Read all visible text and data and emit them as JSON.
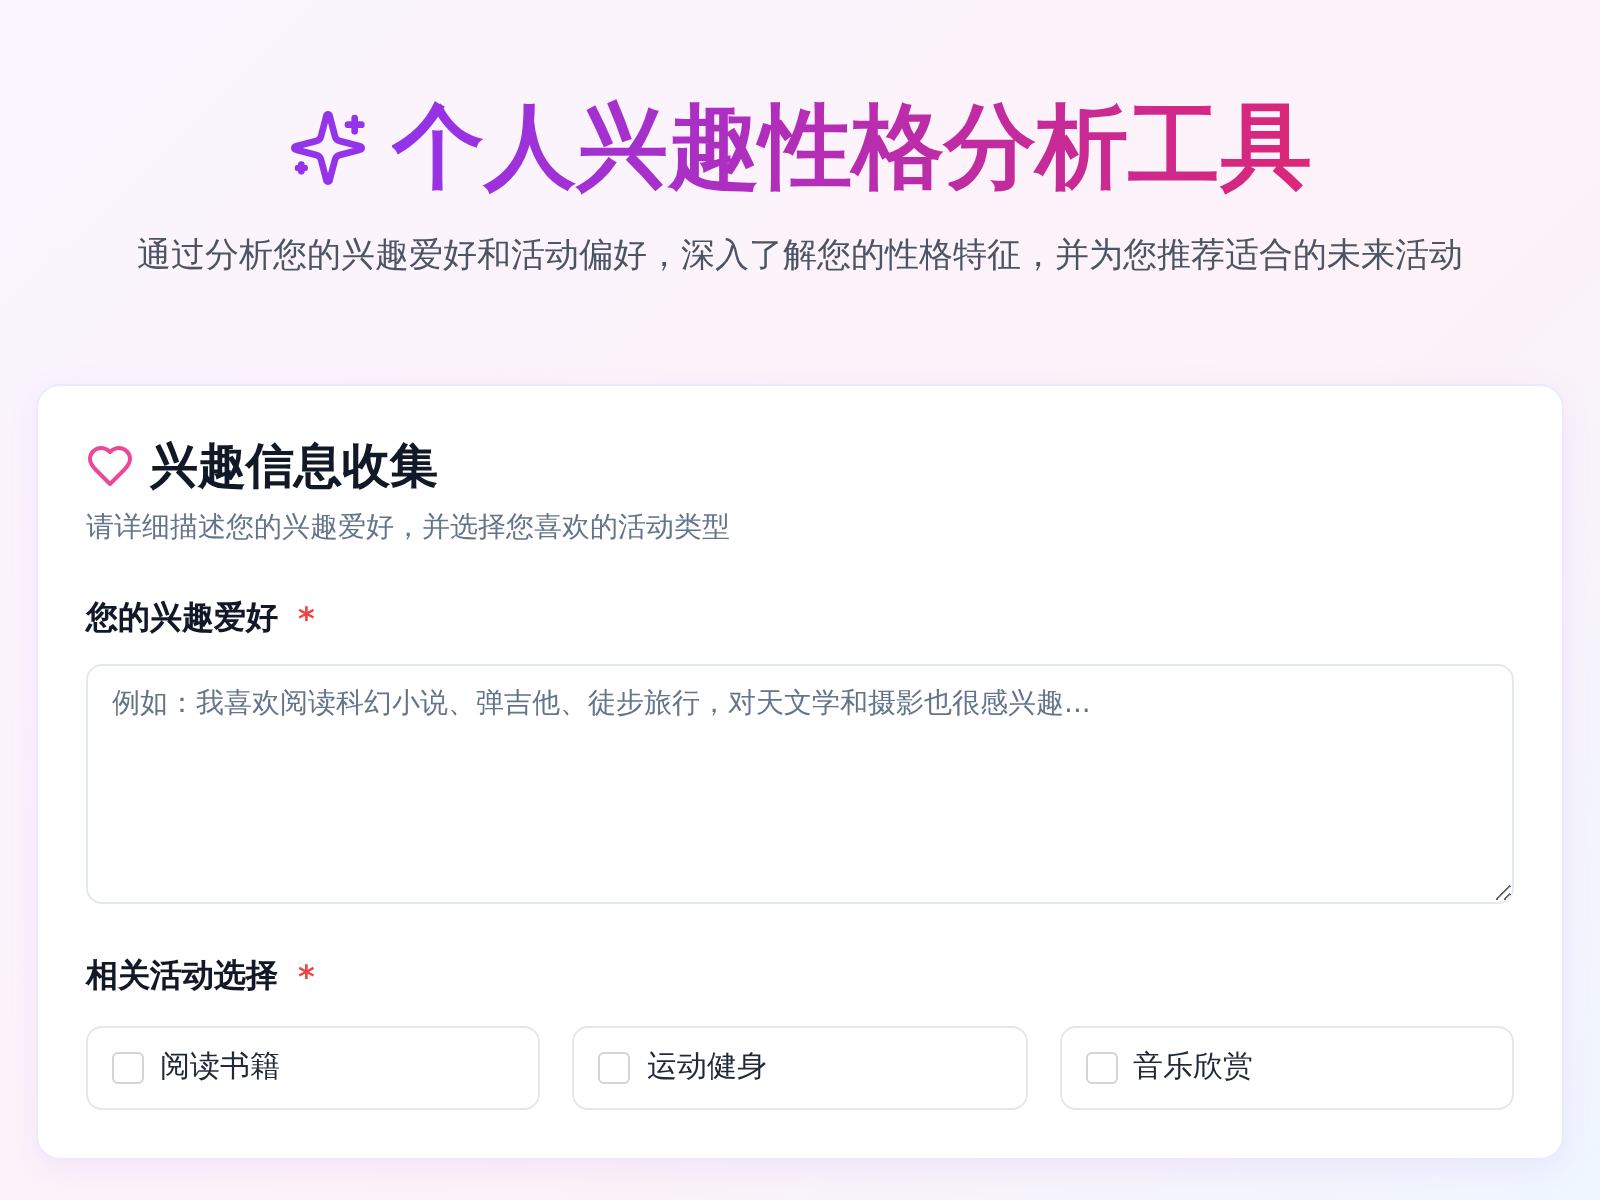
{
  "header": {
    "title": "个人兴趣性格分析工具",
    "subtitle": "通过分析您的兴趣爱好和活动偏好，深入了解您的性格特征，并为您推荐适合的未来活动"
  },
  "card": {
    "title": "兴趣信息收集",
    "description": "请详细描述您的兴趣爱好，并选择您喜欢的活动类型",
    "interests": {
      "label": "您的兴趣爱好",
      "required_mark": "*",
      "placeholder": "例如：我喜欢阅读科幻小说、弹吉他、徒步旅行，对天文学和摄影也很感兴趣..."
    },
    "activities": {
      "label": "相关活动选择",
      "required_mark": "*",
      "options": [
        {
          "label": "阅读书籍",
          "checked": false
        },
        {
          "label": "运动健身",
          "checked": false
        },
        {
          "label": "音乐欣赏",
          "checked": false
        }
      ]
    }
  }
}
